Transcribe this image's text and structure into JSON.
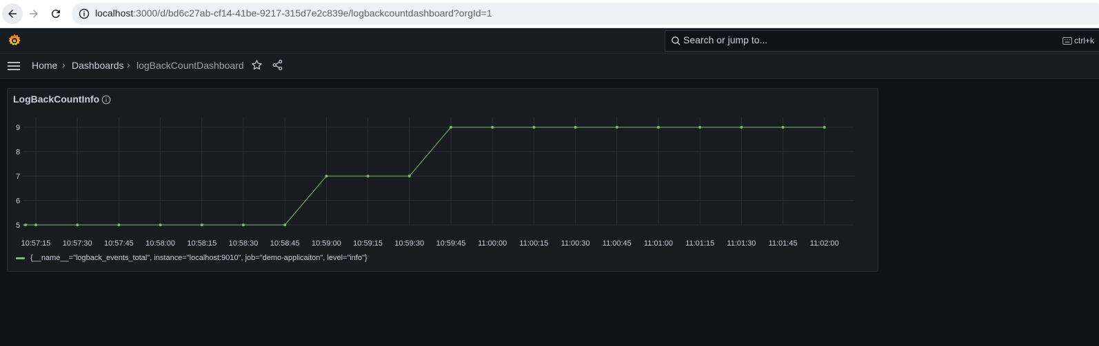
{
  "browser": {
    "url_host": "localhost",
    "url_rest": ":3000/d/bd6c27ab-cf14-41be-9217-315d7e2c839e/logbackcountdashboard?orgId=1"
  },
  "topnav": {
    "search_placeholder": "Search or jump to...",
    "shortcut_hint": "ctrl+k"
  },
  "breadcrumb": {
    "items": [
      "Home",
      "Dashboards",
      "logBackCountDashboard"
    ],
    "separator": "›"
  },
  "panel": {
    "title": "LogBackCountInfo"
  },
  "colors": {
    "series": "#73bf69",
    "grid": "#2c2f35",
    "axis_text": "#ccccdc"
  },
  "chart_data": {
    "type": "line",
    "title": "LogBackCountInfo",
    "x": [
      "10:57:15",
      "10:57:30",
      "10:57:45",
      "10:58:00",
      "10:58:15",
      "10:58:30",
      "10:58:45",
      "10:59:00",
      "10:59:15",
      "10:59:30",
      "10:59:45",
      "11:00:00",
      "11:00:15",
      "11:00:30",
      "11:00:45",
      "11:01:00",
      "11:01:15",
      "11:01:30",
      "11:01:45",
      "11:02:00"
    ],
    "series": [
      {
        "name": "{__name__=\"logback_events_total\", instance=\"localhost:9010\", job=\"demo-applicaiton\", level=\"info\"}",
        "values": [
          5,
          5,
          5,
          5,
          5,
          5,
          5,
          7,
          7,
          7,
          9,
          9,
          9,
          9,
          9,
          9,
          9,
          9,
          9,
          9
        ]
      }
    ],
    "yticks": [
      5,
      6,
      7,
      8,
      9
    ],
    "ylim": [
      5,
      9
    ],
    "grid": true,
    "legend": "bottom-left"
  }
}
